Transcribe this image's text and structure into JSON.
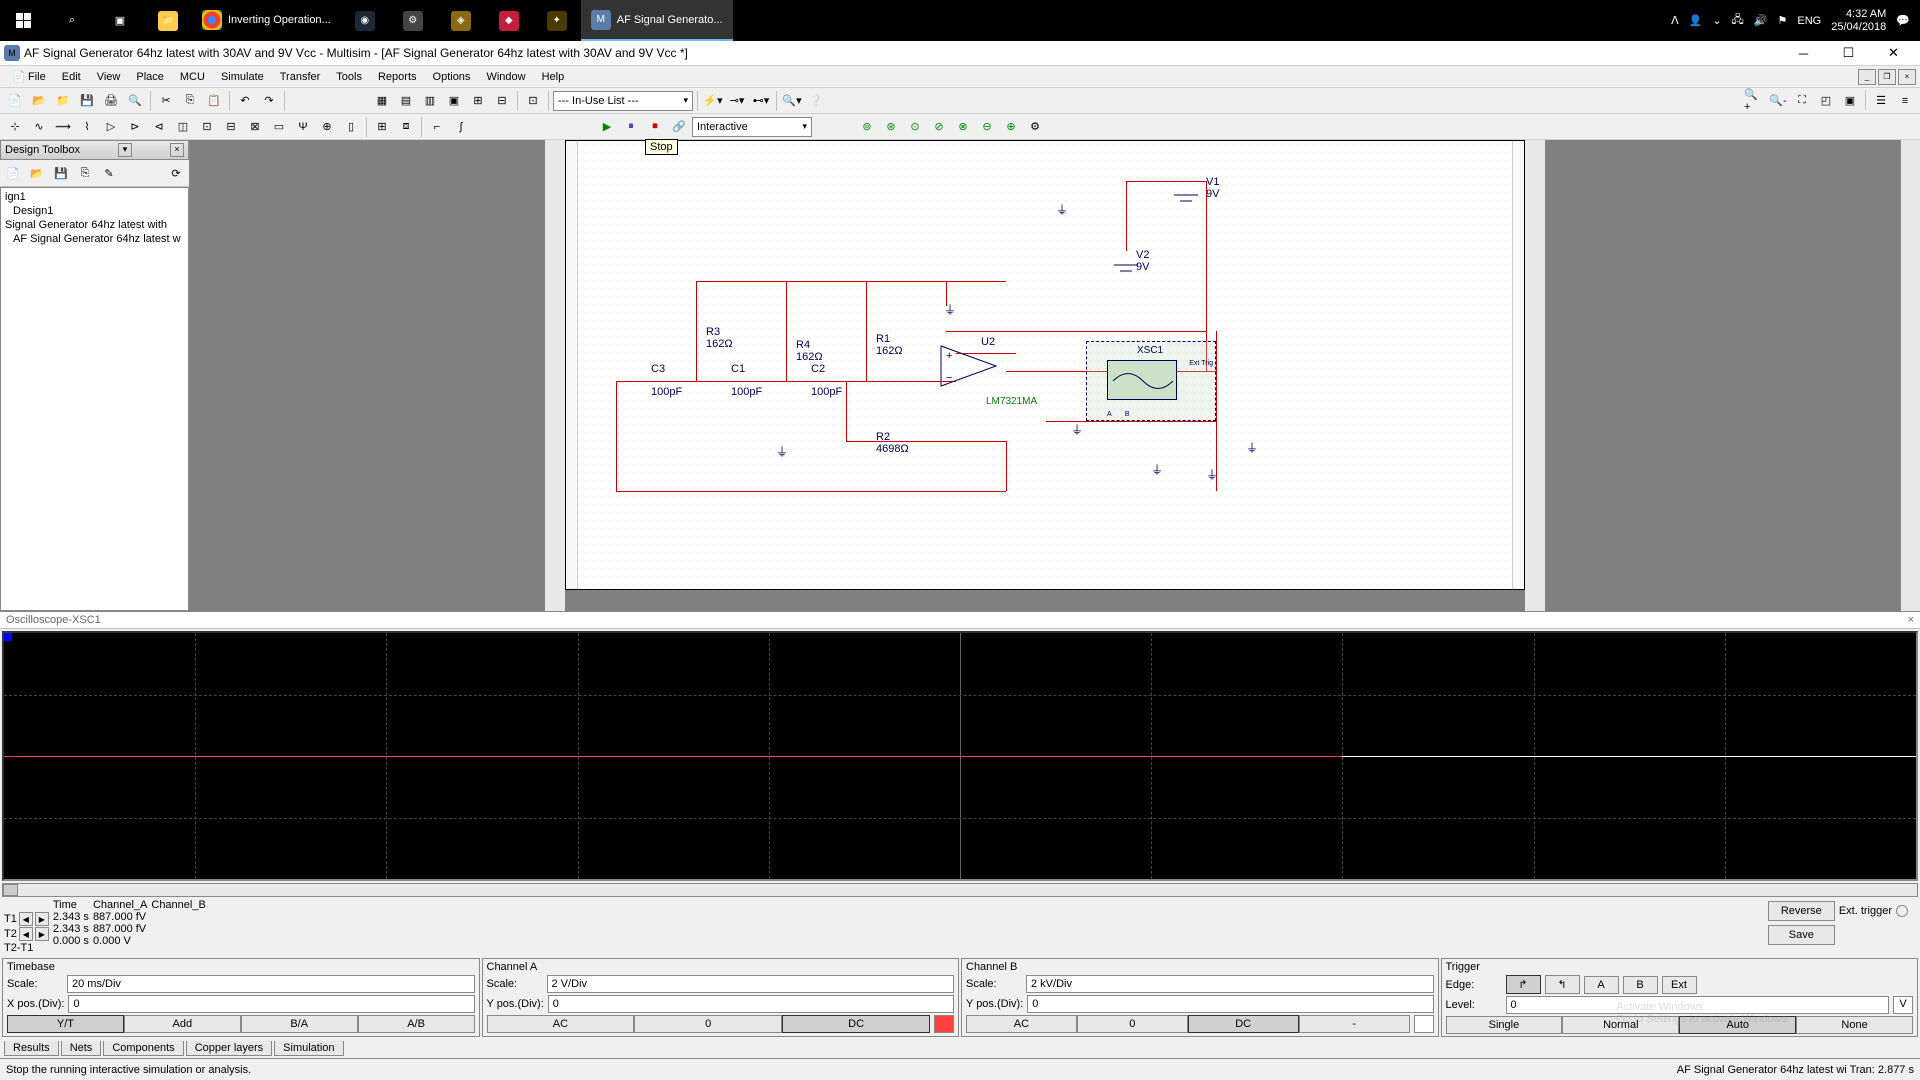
{
  "taskbar": {
    "apps": [
      {
        "name": "start",
        "label": ""
      },
      {
        "name": "search",
        "label": ""
      },
      {
        "name": "taskview",
        "label": ""
      },
      {
        "name": "explorer",
        "label": ""
      },
      {
        "name": "chrome",
        "label": "Inverting Operation..."
      },
      {
        "name": "steam",
        "label": ""
      },
      {
        "name": "app2",
        "label": ""
      },
      {
        "name": "app3",
        "label": ""
      },
      {
        "name": "app4",
        "label": ""
      },
      {
        "name": "app5",
        "label": ""
      },
      {
        "name": "multisim",
        "label": "AF Signal Generato..."
      }
    ],
    "lang": "ENG",
    "time": "4:32 AM",
    "date": "25/04/2018"
  },
  "window": {
    "title": "AF Signal Generator 64hz latest with 30AV and 9V Vcc - Multisim - [AF Signal Generator 64hz latest with 30AV and 9V Vcc *]"
  },
  "menu": [
    "File",
    "Edit",
    "View",
    "Place",
    "MCU",
    "Simulate",
    "Transfer",
    "Tools",
    "Reports",
    "Options",
    "Window",
    "Help"
  ],
  "toolbar1": {
    "inuse": "--- In-Use List ---"
  },
  "toolbar2": {
    "mode": "Interactive",
    "tooltip": "Stop"
  },
  "design_toolbox": {
    "title": "Design Toolbox",
    "items": [
      "ign1",
      "Design1",
      "Signal Generator 64hz latest with",
      "AF Signal Generator 64hz latest w"
    ]
  },
  "schematic": {
    "components": {
      "V1": {
        "name": "V1",
        "val": "9V"
      },
      "V2": {
        "name": "V2",
        "val": "9V"
      },
      "R1": {
        "name": "R1",
        "val": "162Ω"
      },
      "R2": {
        "name": "R2",
        "val": "4698Ω"
      },
      "R3": {
        "name": "R3",
        "val": "162Ω"
      },
      "R4": {
        "name": "R4",
        "val": "162Ω"
      },
      "C1": {
        "name": "C1",
        "val": "100pF"
      },
      "C2": {
        "name": "C2",
        "val": "100pF"
      },
      "C3": {
        "name": "C3",
        "val": "100pF"
      },
      "U2": {
        "name": "U2",
        "val": "LM7321MA"
      },
      "XSC1": "XSC1"
    }
  },
  "oscilloscope": {
    "title": "Oscilloscope-XSC1",
    "cursors": {
      "hdr_time": "Time",
      "hdr_cha": "Channel_A",
      "hdr_chb": "Channel_B",
      "t1_lbl": "T1",
      "t1_time": "2.343 s",
      "t1_cha": "887.000 fV",
      "t2_lbl": "T2",
      "t2_time": "2.343 s",
      "t2_cha": "887.000 fV",
      "dt_lbl": "T2-T1",
      "dt_time": "0.000 s",
      "dt_cha": "0.000 V"
    },
    "btn_reverse": "Reverse",
    "btn_save": "Save",
    "ext_trigger": "Ext. trigger",
    "timebase": {
      "hdr": "Timebase",
      "scale_lbl": "Scale:",
      "scale": "20 ms/Div",
      "xpos_lbl": "X pos.(Div):",
      "xpos": "0",
      "modes": [
        "Y/T",
        "Add",
        "B/A",
        "A/B"
      ]
    },
    "cha": {
      "hdr": "Channel A",
      "scale_lbl": "Scale:",
      "scale": "2 V/Div",
      "ypos_lbl": "Y pos.(Div):",
      "ypos": "0",
      "modes": [
        "AC",
        "0",
        "DC"
      ]
    },
    "chb": {
      "hdr": "Channel B",
      "scale_lbl": "Scale:",
      "scale": "2 kV/Div",
      "ypos_lbl": "Y pos.(Div):",
      "ypos": "0",
      "modes": [
        "AC",
        "0",
        "DC",
        "-"
      ]
    },
    "trigger": {
      "hdr": "Trigger",
      "edge_lbl": "Edge:",
      "level_lbl": "Level:",
      "level": "0",
      "level_unit": "V",
      "edge_btns": [
        "↱",
        "↰",
        "A",
        "B",
        "Ext"
      ],
      "modes": [
        "Single",
        "Normal",
        "Auto",
        "None"
      ]
    }
  },
  "tabs": [
    "Results",
    "Nets",
    "Components",
    "Copper layers",
    "Simulation"
  ],
  "statusbar": {
    "left": "Stop the running interactive simulation or analysis.",
    "right": "AF Signal Generator 64hz latest wi  Tran: 2.877 s"
  },
  "watermark": {
    "line1": "Activate Windows",
    "line2": "Go to Settings to activate Windows."
  }
}
